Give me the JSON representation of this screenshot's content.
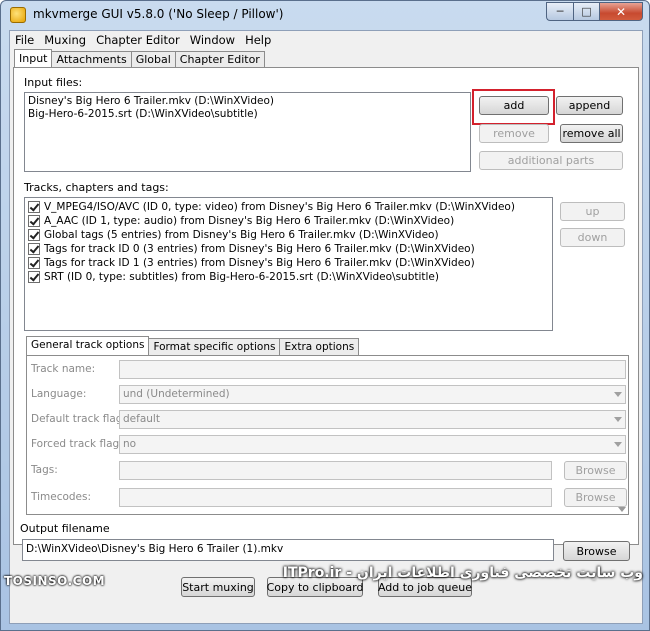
{
  "window": {
    "title": "mkvmerge GUI v5.8.0 ('No Sleep / Pillow')",
    "caption": {
      "minimize": "─",
      "maximize": "□",
      "close": "✕"
    }
  },
  "menu": [
    "File",
    "Muxing",
    "Chapter Editor",
    "Window",
    "Help"
  ],
  "tabs": [
    "Input",
    "Attachments",
    "Global",
    "Chapter Editor"
  ],
  "input": {
    "files_label": "Input files:",
    "files": [
      "Disney's Big Hero 6  Trailer.mkv (D:\\WinXVideo)",
      "Big-Hero-6-2015.srt (D:\\WinXVideo\\subtitle)"
    ],
    "buttons": {
      "add": "add",
      "append": "append",
      "remove": "remove",
      "remove_all": "remove all",
      "additional_parts": "additional parts"
    },
    "tracks_label": "Tracks, chapters and tags:",
    "tracks": [
      "V_MPEG4/ISO/AVC (ID 0, type: video) from Disney's Big Hero 6  Trailer.mkv (D:\\WinXVideo)",
      "A_AAC (ID 1, type: audio) from Disney's Big Hero 6  Trailer.mkv (D:\\WinXVideo)",
      "Global tags (5 entries) from Disney's Big Hero 6  Trailer.mkv (D:\\WinXVideo)",
      "Tags for track ID 0 (3 entries) from Disney's Big Hero 6  Trailer.mkv (D:\\WinXVideo)",
      "Tags for track ID 1 (3 entries) from Disney's Big Hero 6  Trailer.mkv (D:\\WinXVideo)",
      "SRT (ID 0, type: subtitles) from Big-Hero-6-2015.srt (D:\\WinXVideo\\subtitle)"
    ],
    "track_buttons": {
      "up": "up",
      "down": "down"
    }
  },
  "track_options": {
    "tabs": [
      "General track options",
      "Format specific options",
      "Extra options"
    ],
    "fields": {
      "track_name_label": "Track name:",
      "track_name_value": "",
      "language_label": "Language:",
      "language_value": "und (Undetermined)",
      "default_flag_label": "Default track flag:",
      "default_flag_value": "default",
      "forced_flag_label": "Forced track flag:",
      "forced_flag_value": "no",
      "tags_label": "Tags:",
      "tags_value": "",
      "timecodes_label": "Timecodes:",
      "timecodes_value": "",
      "browse": "Browse"
    }
  },
  "output": {
    "label": "Output filename",
    "value": "D:\\WinXVideo\\Disney's Big Hero 6  Trailer (1).mkv",
    "browse": "Browse"
  },
  "actions": {
    "start": "Start muxing",
    "copy": "Copy to clipboard",
    "job": "Add to job queue"
  },
  "watermarks": {
    "left": "TOSINSO.COM",
    "right": "وب سایت تخصصی فناوری اطلاعات ایران - ITPro.ir"
  },
  "colors": {
    "highlight": "#d3212d",
    "titlebar": "#b8cfe9",
    "close": "#c74a30"
  }
}
